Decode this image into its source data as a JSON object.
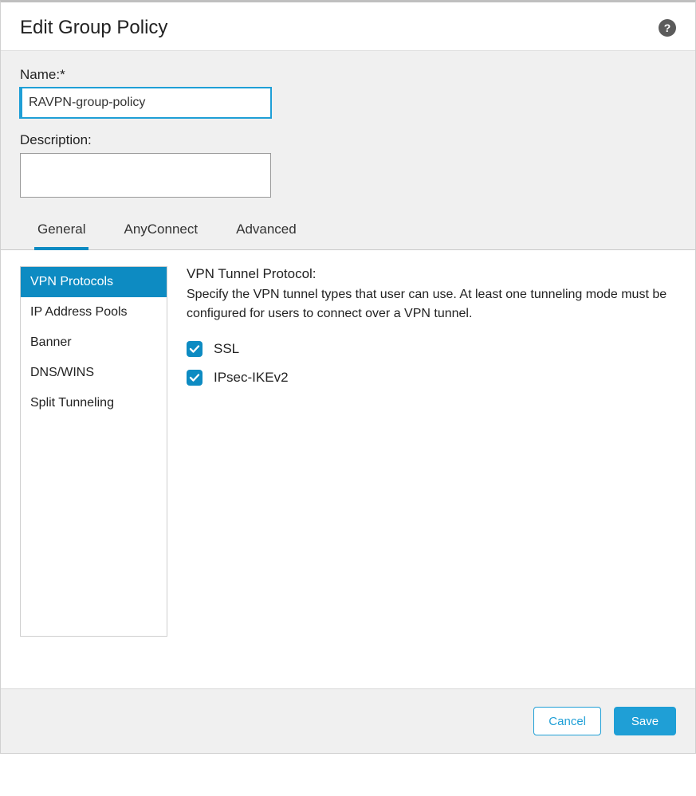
{
  "header": {
    "title": "Edit Group Policy",
    "help_glyph": "?"
  },
  "form": {
    "name_label": "Name:*",
    "name_value": "RAVPN-group-policy",
    "description_label": "Description:",
    "description_value": ""
  },
  "tabs": [
    {
      "id": "general",
      "label": "General",
      "active": true
    },
    {
      "id": "anyconnect",
      "label": "AnyConnect",
      "active": false
    },
    {
      "id": "advanced",
      "label": "Advanced",
      "active": false
    }
  ],
  "side_nav": [
    {
      "id": "vpn-protocols",
      "label": "VPN Protocols",
      "active": true
    },
    {
      "id": "ip-address-pools",
      "label": "IP Address Pools",
      "active": false
    },
    {
      "id": "banner",
      "label": "Banner",
      "active": false
    },
    {
      "id": "dns-wins",
      "label": "DNS/WINS",
      "active": false
    },
    {
      "id": "split-tunneling",
      "label": "Split Tunneling",
      "active": false
    }
  ],
  "panel": {
    "title": "VPN Tunnel Protocol:",
    "description": "Specify the VPN tunnel types that user can use. At least one tunneling mode must be configured for users to connect over a VPN tunnel.",
    "checkboxes": [
      {
        "id": "ssl",
        "label": "SSL",
        "checked": true
      },
      {
        "id": "ipsec-ikev2",
        "label": "IPsec-IKEv2",
        "checked": true
      }
    ]
  },
  "footer": {
    "cancel_label": "Cancel",
    "save_label": "Save"
  },
  "colors": {
    "accent": "#0d8bc2",
    "accent_light": "#1f9fd6"
  }
}
